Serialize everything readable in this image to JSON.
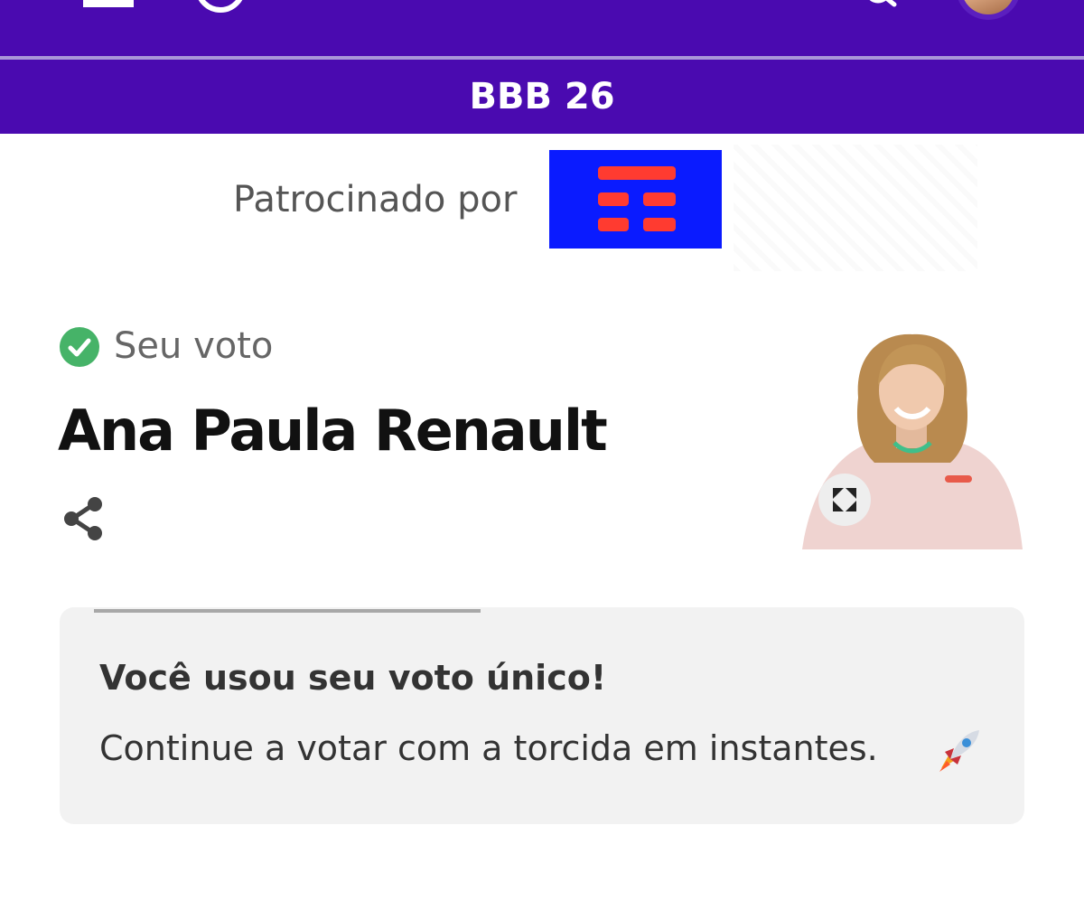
{
  "header": {
    "section_title": "BBB 26",
    "brand_color": "#4a0ab0",
    "icons": [
      "menu-icon",
      "logo-icon",
      "search-icon",
      "user-avatar"
    ]
  },
  "sponsor": {
    "label": "Patrocinado por"
  },
  "vote": {
    "status_label": "Seu voto",
    "candidate_name": "Ana Paula Renault",
    "status_color": "#46b368",
    "icons": [
      "check-circle-icon",
      "share-icon",
      "expand-icon"
    ]
  },
  "card": {
    "heading": "Você usou seu voto único!",
    "message": "Continue a votar com a torcida em instantes.",
    "icon": "rocket-icon"
  }
}
